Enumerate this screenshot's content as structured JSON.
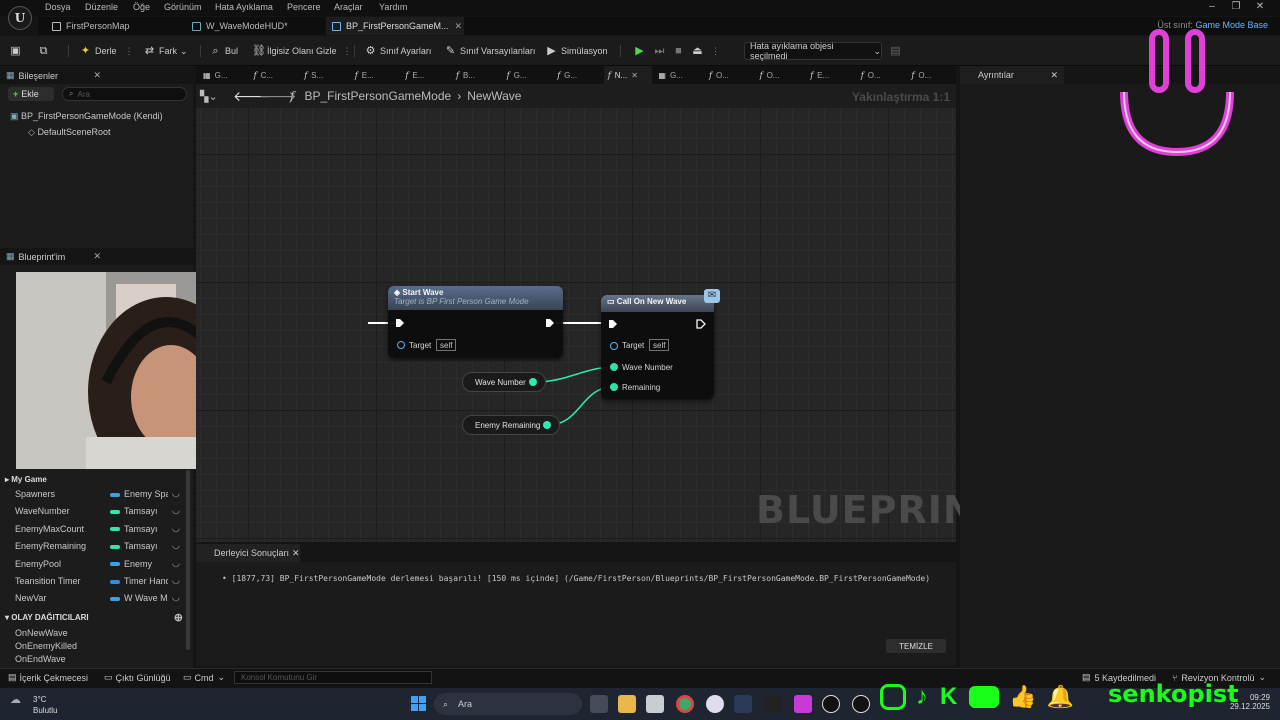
{
  "menu": [
    "Dosya",
    "Düzenle",
    "Öğe",
    "Görünüm",
    "Hata Ayıklama",
    "Pencere",
    "Araçlar",
    "Yardım"
  ],
  "doc_tabs": [
    {
      "label": "FirstPersonMap"
    },
    {
      "label": "W_WaveModeHUD*"
    },
    {
      "label": "BP_FirstPersonGameM..."
    }
  ],
  "parent_class": {
    "label": "Üst sınıf:",
    "value": "Game Mode Base"
  },
  "toolbar": {
    "compile": "Derle",
    "diff": "Fark",
    "find": "Bul",
    "hide_unrelated": "İlgisiz Olanı Gizle",
    "class_settings": "Sınıf Ayarları",
    "class_defaults": "Sınıf Varsayılanları",
    "simulation": "Simülasyon",
    "debug_object": "Hata ayıklama objesi seçilmedi"
  },
  "components": {
    "title": "Bileşenler",
    "add": "Ekle",
    "search_placeholder": "Ara",
    "items": [
      "BP_FirstPersonGameMode (Kendi)",
      "DefaultSceneRoot"
    ]
  },
  "my_blueprint": {
    "title": "Blueprint'im",
    "section_graphs": "My Game",
    "variables": [
      {
        "name": "Spawners",
        "type": "Enemy Spawner",
        "color": "#3aa0e8"
      },
      {
        "name": "WaveNumber",
        "type": "Tamsayı",
        "color": "#2ee8b0"
      },
      {
        "name": "EnemyMaxCount",
        "type": "Tamsayı",
        "color": "#2ee8b0"
      },
      {
        "name": "EnemyRemaining",
        "type": "Tamsayı",
        "color": "#2ee8b0"
      },
      {
        "name": "EnemyPool",
        "type": "Enemy",
        "color": "#3aa0e8"
      },
      {
        "name": "Teansition Timer",
        "type": "Timer Handle",
        "color": "#2b8fe0"
      },
      {
        "name": "NewVar",
        "type": "W Wave Mode HUD",
        "color": "#3aa0e8"
      }
    ],
    "dispatchers_title": "OLAY DAĞITICILARI",
    "dispatchers": [
      "OnNewWave",
      "OnEnemyKilled",
      "OnEndWave"
    ]
  },
  "graph_tabs": [
    "G...",
    "C...",
    "S...",
    "E...",
    "E...",
    "B...",
    "G...",
    "G...",
    "N...",
    "G...",
    "O...",
    "O...",
    "E...",
    "O...",
    "O..."
  ],
  "breadcrumb": {
    "root": "BP_FirstPersonGameMode",
    "sep": "›",
    "leaf": "NewWave"
  },
  "zoom": "Yakınlaştırma 1:1",
  "watermark": "BLUEPRINT",
  "nodes": {
    "start_wave": {
      "title": "Start Wave",
      "subtitle": "Target is BP First Person Game Mode",
      "target": "Target",
      "self": "self"
    },
    "call_new_wave": {
      "title": "Call On New Wave",
      "target": "Target",
      "self": "self",
      "pin1": "Wave Number",
      "pin2": "Remaining"
    },
    "var_wave_number": "Wave Number",
    "var_enemy_remaining": "Enemy Remaining"
  },
  "details": {
    "title": "Ayrıntılar"
  },
  "compiler": {
    "tab": "Derleyici Sonuçları",
    "message": "[1877,73] BP_FirstPersonGameMode derlemesi başarılı! [150 ms içinde] (/Game/FirstPerson/Blueprints/BP_FirstPersonGameMode.BP_FirstPersonGameMode)",
    "clear": "TEMİZLE"
  },
  "statusbar": {
    "content_drawer": "İçerik Çekmecesi",
    "output_log": "Çıktı Günlüğü",
    "cmd": "Cmd",
    "cmd_placeholder": "Konsol Komutunu Gir",
    "saved": "5 Kaydedilmedi",
    "revision": "Revizyon Kontrolü"
  },
  "taskbar": {
    "weather_temp": "3°C",
    "weather_desc": "Bulutlu",
    "search": "Ara",
    "time": "09:29",
    "date": "29.12.2025"
  },
  "overlay": {
    "channel": "senkopist",
    "social_colors": "#19ff19",
    "smiley_color": "#e040d8"
  }
}
